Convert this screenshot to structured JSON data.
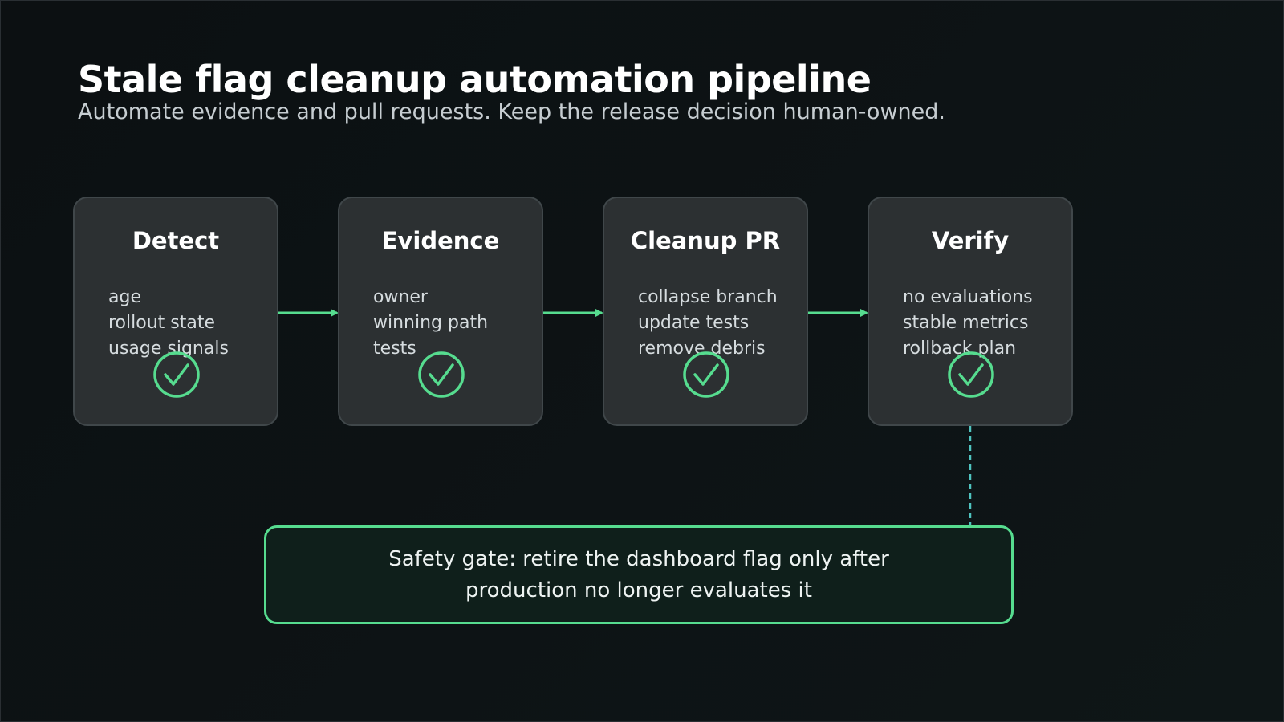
{
  "header": {
    "title": "Stale flag cleanup automation pipeline",
    "subtitle": "Automate evidence and pull requests. Keep the release decision human-owned."
  },
  "stages": [
    {
      "title": "Detect",
      "items": [
        "age",
        "rollout state",
        "usage signals"
      ],
      "status_icon": "check-circle-icon"
    },
    {
      "title": "Evidence",
      "items": [
        "owner",
        "winning path",
        "tests"
      ],
      "status_icon": "check-circle-icon"
    },
    {
      "title": "Cleanup PR",
      "items": [
        "collapse branch",
        "update tests",
        "remove debris"
      ],
      "status_icon": "check-circle-icon"
    },
    {
      "title": "Verify",
      "items": [
        "no evaluations",
        "stable metrics",
        "rollback plan"
      ],
      "status_icon": "check-circle-icon"
    }
  ],
  "gate": {
    "text": "Safety gate: retire the dashboard flag only after production no longer evaluates it"
  },
  "colors": {
    "accent_green": "#56dc8f",
    "connector_dashed": "#4fc4c0",
    "card_bg": "#2c3032",
    "gate_bg": "#0f1f1b"
  }
}
